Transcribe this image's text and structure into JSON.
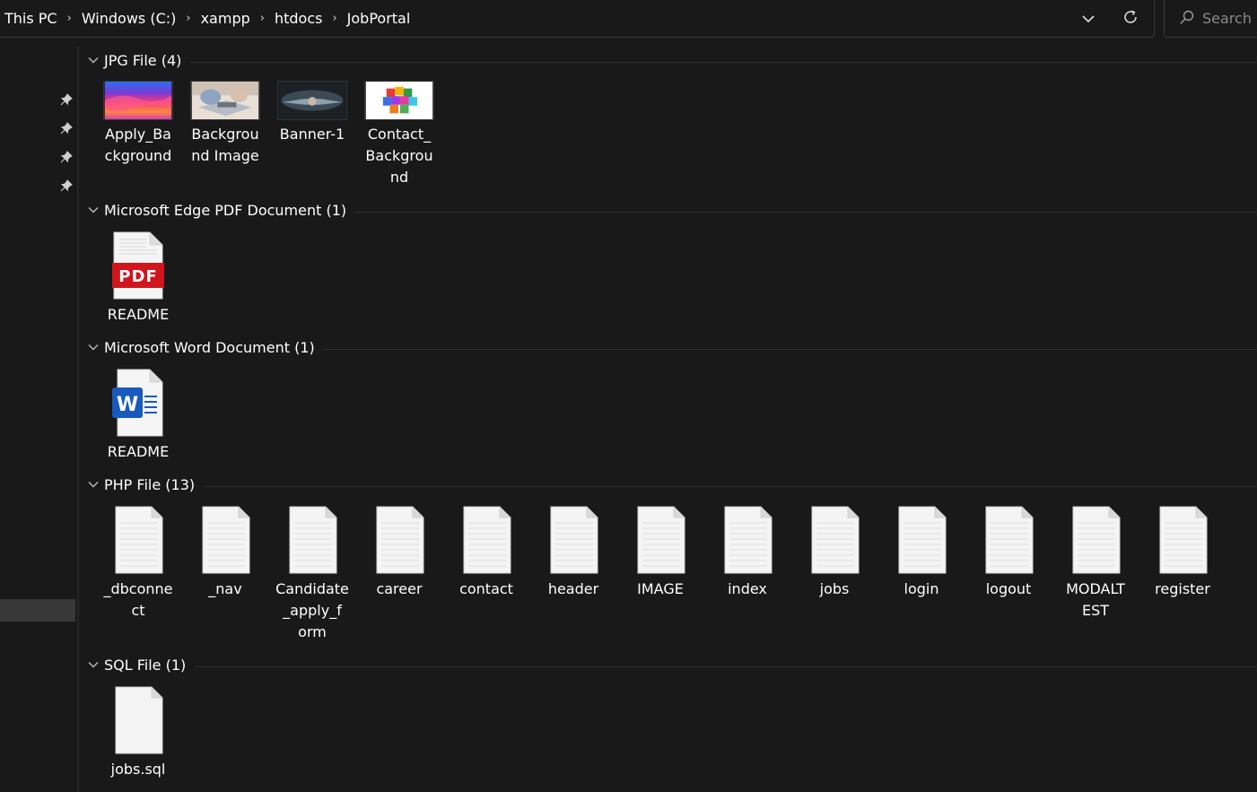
{
  "breadcrumb": {
    "items": [
      "This PC",
      "Windows (C:)",
      "xampp",
      "htdocs",
      "JobPortal"
    ],
    "separator": "›"
  },
  "search": {
    "placeholder": "Search"
  },
  "icons": {
    "dropdown": "chevron-down-icon",
    "refresh": "refresh-icon",
    "search": "search-icon",
    "pin": "pin-icon"
  },
  "groups": [
    {
      "title": "JPG File (4)",
      "items": [
        {
          "name": "Apply_Background",
          "label_lines": [
            "Apply_Ba",
            "ckground"
          ],
          "icon": "image-thumbnail-gradient"
        },
        {
          "name": "Background Image",
          "label_lines": [
            "Backgrou",
            "nd Image"
          ],
          "icon": "image-thumbnail-laptop"
        },
        {
          "name": "Banner-1",
          "label_lines": [
            "Banner-1"
          ],
          "icon": "image-thumbnail-handshake"
        },
        {
          "name": "Contact_Background",
          "label_lines": [
            "Contact_",
            "Backgrou",
            "nd"
          ],
          "icon": "image-thumbnail-question-cubes"
        }
      ]
    },
    {
      "title": "Microsoft Edge PDF Document (1)",
      "items": [
        {
          "name": "README",
          "label_lines": [
            "README"
          ],
          "icon": "pdf-file-icon",
          "badge": "PDF"
        }
      ]
    },
    {
      "title": "Microsoft Word Document (1)",
      "items": [
        {
          "name": "README",
          "label_lines": [
            "README"
          ],
          "icon": "word-file-icon",
          "badge": "W"
        }
      ]
    },
    {
      "title": "PHP File (13)",
      "items": [
        {
          "name": "_dbconnect",
          "label_lines": [
            "_dbconne",
            "ct"
          ],
          "icon": "text-file-icon"
        },
        {
          "name": "_nav",
          "label_lines": [
            "_nav"
          ],
          "icon": "text-file-icon"
        },
        {
          "name": "Candidate_apply_form",
          "label_lines": [
            "Candidate",
            "_apply_f",
            "orm"
          ],
          "icon": "text-file-icon"
        },
        {
          "name": "career",
          "label_lines": [
            "career"
          ],
          "icon": "text-file-icon"
        },
        {
          "name": "contact",
          "label_lines": [
            "contact"
          ],
          "icon": "text-file-icon"
        },
        {
          "name": "header",
          "label_lines": [
            "header"
          ],
          "icon": "text-file-icon"
        },
        {
          "name": "IMAGE",
          "label_lines": [
            "IMAGE"
          ],
          "icon": "text-file-icon"
        },
        {
          "name": "index",
          "label_lines": [
            "index"
          ],
          "icon": "text-file-icon"
        },
        {
          "name": "jobs",
          "label_lines": [
            "jobs"
          ],
          "icon": "text-file-icon"
        },
        {
          "name": "login",
          "label_lines": [
            "login"
          ],
          "icon": "text-file-icon"
        },
        {
          "name": "logout",
          "label_lines": [
            "logout"
          ],
          "icon": "text-file-icon"
        },
        {
          "name": "MODALTEST",
          "label_lines": [
            "MODALT",
            "EST"
          ],
          "icon": "text-file-icon"
        },
        {
          "name": "register",
          "label_lines": [
            "register"
          ],
          "icon": "text-file-icon"
        }
      ]
    },
    {
      "title": "SQL File (1)",
      "items": [
        {
          "name": "jobs.sql",
          "label_lines": [
            "jobs.sql"
          ],
          "icon": "blank-file-icon"
        }
      ]
    }
  ],
  "colors": {
    "background": "#191919",
    "text": "#ffffff",
    "border": "#3a3a3a",
    "pdf_red": "#d0151c",
    "word_blue": "#185abd"
  }
}
